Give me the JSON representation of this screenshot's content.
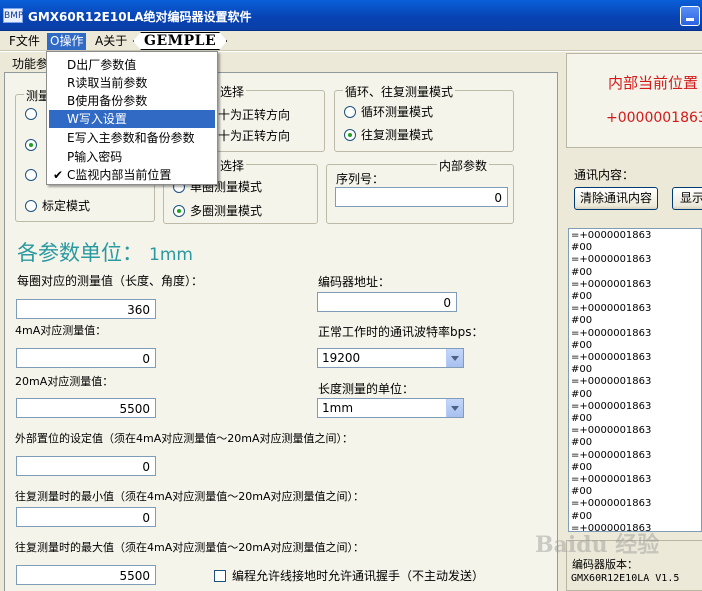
{
  "window": {
    "icon_text": "BMP",
    "title": "GMX60R12E10LA绝对编码器设置软件"
  },
  "menubar": {
    "file": "F文件",
    "operate": "O操作",
    "about": "A关于",
    "brand": "GEMPLE"
  },
  "operate_menu": {
    "items": [
      {
        "label": "D出厂参数值",
        "checked": false
      },
      {
        "label": "R读取当前参数",
        "checked": false
      },
      {
        "label": "B使用备份参数",
        "checked": false
      },
      {
        "label": "W写入设置",
        "checked": false
      },
      {
        "label": "E写入主参数和备份参数",
        "checked": false
      },
      {
        "label": "P输入密码",
        "checked": false
      },
      {
        "label": "C监视内部当前位置",
        "checked": true
      }
    ],
    "highlighted_index": 3
  },
  "tab": {
    "label": "功能参"
  },
  "measure_group": {
    "title": "测量",
    "options": [
      "",
      "",
      "",
      "标定模式"
    ],
    "selected_index": 1
  },
  "direction_group": {
    "title": "选择",
    "options": [
      "十为正转方向",
      "十为正转方向"
    ]
  },
  "loop_group": {
    "title": "循环、往复测量模式",
    "options": [
      "循环测量模式",
      "往复测量模式"
    ],
    "selected_index": 1
  },
  "circle_group": {
    "title": "选择",
    "options": [
      "单圈测量模式",
      "多圈测量模式"
    ],
    "selected_index": 1
  },
  "internal_group": {
    "title": "内部参数",
    "serial_label": "序列号：",
    "serial_value": "0"
  },
  "units": {
    "title": "各参数单位：",
    "value": "1mm"
  },
  "fields": {
    "per_turn_label": "每圈对应的测量值（长度、角度）：",
    "per_turn_value": "360",
    "ma4_label": "4mA对应测量值：",
    "ma4_value": "0",
    "ma20_label": "20mA对应测量值：",
    "ma20_value": "5500",
    "preset_label": "外部置位的设定值（须在4mA对应测量值～20mA对应测量值之间）：",
    "preset_value": "0",
    "recip_min_label": "往复测量时的最小值（须在4mA对应测量值～20mA对应测量值之间）：",
    "recip_min_value": "0",
    "recip_max_label": "往复测量时的最大值（须在4mA对应测量值～20mA对应测量值之间）：",
    "recip_max_value": "5500",
    "encoder_addr_label": "编码器地址：",
    "encoder_addr_value": "0",
    "baud_label": "正常工作时的通讯波特率bps：",
    "baud_value": "19200",
    "length_unit_label": "长度测量的单位：",
    "length_unit_value": "1mm",
    "handshake_label": "编程允许线接地时允许通讯握手（不主动发送）",
    "handshake_checked": false
  },
  "right_panel": {
    "pos_title": "内部当前位置",
    "pos_value": "+0000001863",
    "comm_label": "通讯内容：",
    "clear_button": "清除通讯内容",
    "show_button": "显示",
    "log_lines": [
      "=+0000001863",
      "#00",
      "=+0000001863",
      "#00",
      "=+0000001863",
      "#00",
      "=+0000001863",
      "#00",
      "=+0000001863",
      "#00",
      "=+0000001863",
      "#00",
      "=+0000001863",
      "#00",
      "=+0000001863",
      "#00",
      "=+0000001863",
      "#00",
      "=+0000001863",
      "#00",
      "=+0000001863",
      "#00",
      "=+0000001863",
      "#00",
      "=+0000001863",
      "#00",
      "=+0000001863"
    ],
    "version_label": "编码器版本：",
    "version_value": "GMX60R12E10LA V1.5"
  },
  "watermark": "Baidu 经验",
  "colors": {
    "titlebar": "#0842b3",
    "highlight": "#316ac5",
    "position_red": "#d21a1a",
    "units_teal": "#2a9aa0"
  }
}
